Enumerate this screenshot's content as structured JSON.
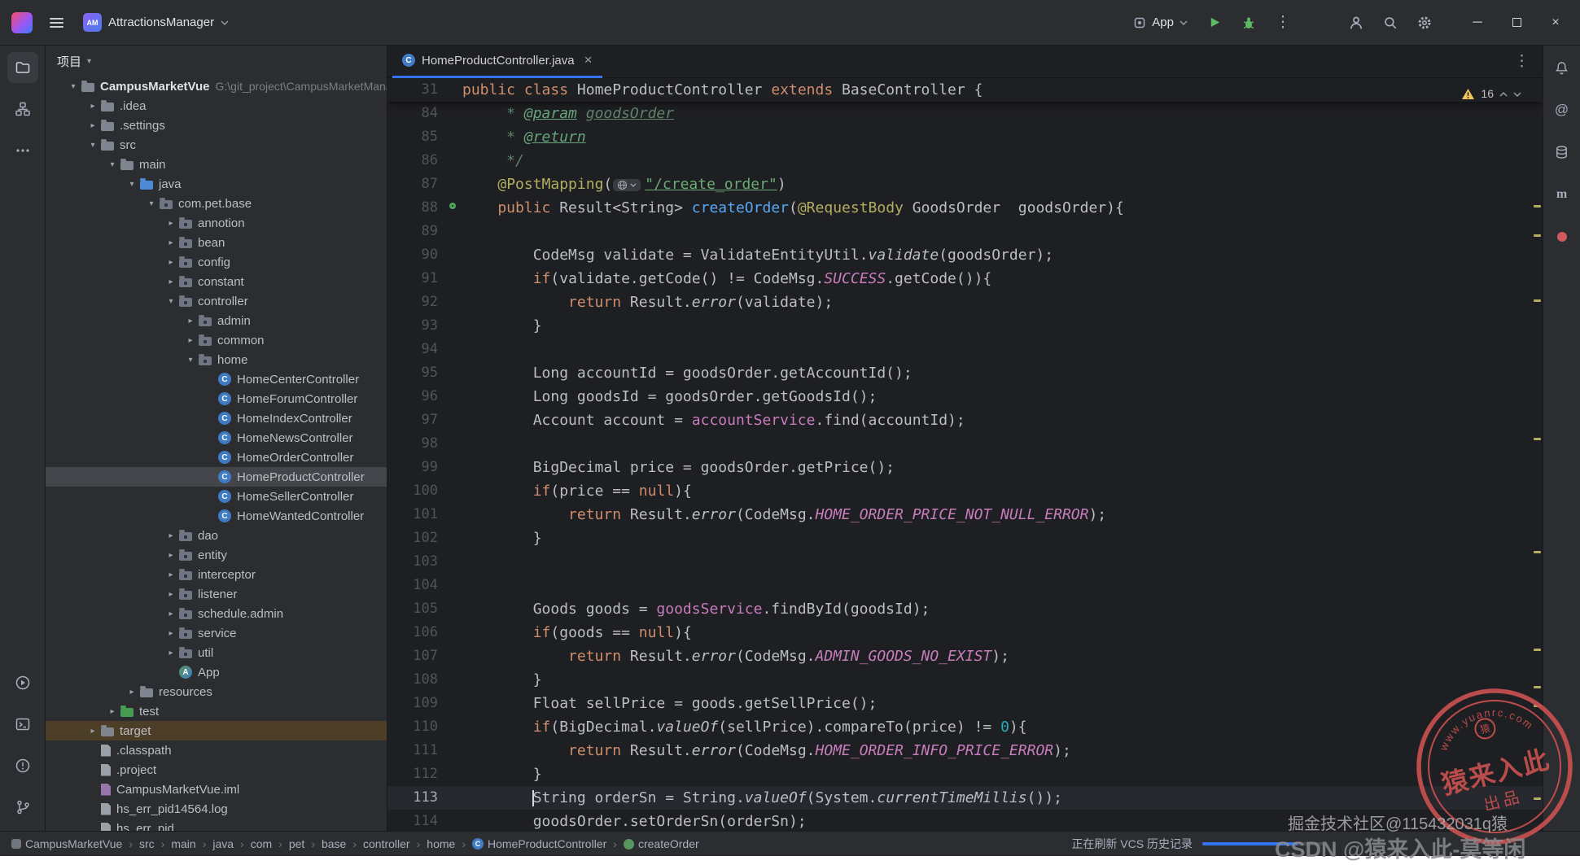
{
  "titlebar": {
    "project": "AttractionsManager",
    "project_badge": "AM",
    "run_config": "App"
  },
  "panel": {
    "header": "项目"
  },
  "tree": [
    {
      "l": 0,
      "c": "d",
      "i": "root",
      "t": "CampusMarketVue",
      "hint": "G:\\git_project\\CampusMarketManager\\Ca",
      "bold": true
    },
    {
      "l": 1,
      "c": "r",
      "i": "folder",
      "t": ".idea"
    },
    {
      "l": 1,
      "c": "r",
      "i": "folder",
      "t": ".settings"
    },
    {
      "l": 1,
      "c": "d",
      "i": "folder",
      "t": "src"
    },
    {
      "l": 2,
      "c": "d",
      "i": "folder",
      "t": "main"
    },
    {
      "l": 3,
      "c": "d",
      "i": "java",
      "t": "java"
    },
    {
      "l": 4,
      "c": "d",
      "i": "pkg",
      "t": "com.pet.base"
    },
    {
      "l": 5,
      "c": "r",
      "i": "pkg",
      "t": "annotion"
    },
    {
      "l": 5,
      "c": "r",
      "i": "pkg",
      "t": "bean"
    },
    {
      "l": 5,
      "c": "r",
      "i": "pkg",
      "t": "config"
    },
    {
      "l": 5,
      "c": "r",
      "i": "pkg",
      "t": "constant"
    },
    {
      "l": 5,
      "c": "d",
      "i": "pkg",
      "t": "controller"
    },
    {
      "l": 6,
      "c": "r",
      "i": "pkg",
      "t": "admin"
    },
    {
      "l": 6,
      "c": "r",
      "i": "pkg",
      "t": "common"
    },
    {
      "l": 6,
      "c": "d",
      "i": "pkg",
      "t": "home"
    },
    {
      "l": 7,
      "c": "",
      "i": "class",
      "t": "HomeCenterController"
    },
    {
      "l": 7,
      "c": "",
      "i": "class",
      "t": "HomeForumController"
    },
    {
      "l": 7,
      "c": "",
      "i": "class",
      "t": "HomeIndexController"
    },
    {
      "l": 7,
      "c": "",
      "i": "class",
      "t": "HomeNewsController"
    },
    {
      "l": 7,
      "c": "",
      "i": "class",
      "t": "HomeOrderController"
    },
    {
      "l": 7,
      "c": "",
      "i": "class",
      "t": "HomeProductController",
      "sel": true
    },
    {
      "l": 7,
      "c": "",
      "i": "class",
      "t": "HomeSellerController"
    },
    {
      "l": 7,
      "c": "",
      "i": "class",
      "t": "HomeWantedController"
    },
    {
      "l": 5,
      "c": "r",
      "i": "pkg",
      "t": "dao"
    },
    {
      "l": 5,
      "c": "r",
      "i": "pkg",
      "t": "entity"
    },
    {
      "l": 5,
      "c": "r",
      "i": "pkg",
      "t": "interceptor"
    },
    {
      "l": 5,
      "c": "r",
      "i": "pkg",
      "t": "listener"
    },
    {
      "l": 5,
      "c": "r",
      "i": "pkg",
      "t": "schedule.admin"
    },
    {
      "l": 5,
      "c": "r",
      "i": "pkg",
      "t": "service"
    },
    {
      "l": 5,
      "c": "r",
      "i": "pkg",
      "t": "util"
    },
    {
      "l": 5,
      "c": "",
      "i": "app",
      "t": "App"
    },
    {
      "l": 3,
      "c": "r",
      "i": "folder",
      "t": "resources"
    },
    {
      "l": 2,
      "c": "r",
      "i": "test",
      "t": "test"
    },
    {
      "l": 1,
      "c": "r",
      "i": "folder",
      "t": "target",
      "excl": true
    },
    {
      "l": 1,
      "c": "",
      "i": "file",
      "t": ".classpath"
    },
    {
      "l": 1,
      "c": "",
      "i": "file",
      "t": ".project"
    },
    {
      "l": 1,
      "c": "",
      "i": "module-file",
      "t": "CampusMarketVue.iml"
    },
    {
      "l": 1,
      "c": "",
      "i": "log",
      "t": "hs_err_pid14564.log"
    },
    {
      "l": 1,
      "c": "",
      "i": "log",
      "t": "hs_err_pid…"
    }
  ],
  "editor": {
    "tab": "HomeProductController.java",
    "warnings": "16",
    "sticky": {
      "n": "31",
      "tk": [
        [
          "k",
          "public class "
        ],
        [
          "p",
          "HomeProductController "
        ],
        [
          "k",
          "extends"
        ],
        [
          "p",
          " BaseController {"
        ]
      ]
    },
    "lines": [
      {
        "n": "84",
        "tk": [
          [
            "d",
            "     * "
          ],
          [
            "t",
            "@param"
          ],
          [
            "d",
            " "
          ],
          [
            "r",
            "goodsOrder"
          ]
        ]
      },
      {
        "n": "85",
        "tk": [
          [
            "d",
            "     * "
          ],
          [
            "t",
            "@return"
          ]
        ]
      },
      {
        "n": "86",
        "tk": [
          [
            "d",
            "     */"
          ]
        ]
      },
      {
        "n": "87",
        "tk": [
          [
            "p",
            "    "
          ],
          [
            "a",
            "@PostMapping"
          ],
          [
            "p",
            "("
          ],
          [
            "g",
            ""
          ],
          [
            "s",
            "\"/create_order\""
          ],
          [
            "p",
            ")"
          ]
        ]
      },
      {
        "n": "88",
        "g": "endpoint",
        "tk": [
          [
            "k",
            "    public "
          ],
          [
            "p",
            "Result<String> "
          ],
          [
            "m",
            "createOrder"
          ],
          [
            "p",
            "("
          ],
          [
            "a",
            "@RequestBody"
          ],
          [
            "p",
            " GoodsOrder  goodsOrder){"
          ]
        ]
      },
      {
        "n": "89",
        "tk": []
      },
      {
        "n": "90",
        "tk": [
          [
            "p",
            "        CodeMsg validate = ValidateEntityUtil."
          ],
          [
            "i",
            "validate"
          ],
          [
            "p",
            "(goodsOrder);"
          ]
        ]
      },
      {
        "n": "91",
        "tk": [
          [
            "p",
            "        "
          ],
          [
            "k",
            "if"
          ],
          [
            "p",
            "(validate.getCode() != CodeMsg."
          ],
          [
            "c",
            "SUCCESS"
          ],
          [
            "p",
            ".getCode()){"
          ]
        ]
      },
      {
        "n": "92",
        "tk": [
          [
            "p",
            "            "
          ],
          [
            "k",
            "return"
          ],
          [
            "p",
            " Result."
          ],
          [
            "i",
            "error"
          ],
          [
            "p",
            "(validate);"
          ]
        ]
      },
      {
        "n": "93",
        "tk": [
          [
            "p",
            "        }"
          ]
        ]
      },
      {
        "n": "94",
        "tk": []
      },
      {
        "n": "95",
        "tk": [
          [
            "p",
            "        Long accountId = goodsOrder.getAccountId();"
          ]
        ]
      },
      {
        "n": "96",
        "tk": [
          [
            "p",
            "        Long goodsId = goodsOrder.getGoodsId();"
          ]
        ]
      },
      {
        "n": "97",
        "tk": [
          [
            "p",
            "        Account account = "
          ],
          [
            "f",
            "accountService"
          ],
          [
            "p",
            ".find(accountId);"
          ]
        ]
      },
      {
        "n": "98",
        "tk": []
      },
      {
        "n": "99",
        "tk": [
          [
            "p",
            "        BigDecimal price = goodsOrder.getPrice();"
          ]
        ]
      },
      {
        "n": "100",
        "tk": [
          [
            "p",
            "        "
          ],
          [
            "k",
            "if"
          ],
          [
            "p",
            "(price == "
          ],
          [
            "k",
            "null"
          ],
          [
            "p",
            "){"
          ]
        ]
      },
      {
        "n": "101",
        "tk": [
          [
            "p",
            "            "
          ],
          [
            "k",
            "return"
          ],
          [
            "p",
            " Result."
          ],
          [
            "i",
            "error"
          ],
          [
            "p",
            "(CodeMsg."
          ],
          [
            "c",
            "HOME_ORDER_PRICE_NOT_NULL_ERROR"
          ],
          [
            "p",
            ");"
          ]
        ]
      },
      {
        "n": "102",
        "tk": [
          [
            "p",
            "        }"
          ]
        ]
      },
      {
        "n": "103",
        "tk": []
      },
      {
        "n": "104",
        "tk": []
      },
      {
        "n": "105",
        "tk": [
          [
            "p",
            "        Goods goods = "
          ],
          [
            "f",
            "goodsService"
          ],
          [
            "p",
            ".findById(goodsId);"
          ]
        ]
      },
      {
        "n": "106",
        "tk": [
          [
            "p",
            "        "
          ],
          [
            "k",
            "if"
          ],
          [
            "p",
            "(goods == "
          ],
          [
            "k",
            "null"
          ],
          [
            "p",
            "){"
          ]
        ]
      },
      {
        "n": "107",
        "tk": [
          [
            "p",
            "            "
          ],
          [
            "k",
            "return"
          ],
          [
            "p",
            " Result."
          ],
          [
            "i",
            "error"
          ],
          [
            "p",
            "(CodeMsg."
          ],
          [
            "c",
            "ADMIN_GOODS_NO_EXIST"
          ],
          [
            "p",
            ");"
          ]
        ]
      },
      {
        "n": "108",
        "tk": [
          [
            "p",
            "        }"
          ]
        ]
      },
      {
        "n": "109",
        "tk": [
          [
            "p",
            "        Float sellPrice = goods.getSellPrice();"
          ]
        ]
      },
      {
        "n": "110",
        "tk": [
          [
            "p",
            "        "
          ],
          [
            "k",
            "if"
          ],
          [
            "p",
            "(BigDecimal."
          ],
          [
            "i",
            "valueOf"
          ],
          [
            "p",
            "(sellPrice).compareTo(price) != "
          ],
          [
            "n2",
            "0"
          ],
          [
            "p",
            "){"
          ]
        ]
      },
      {
        "n": "111",
        "tk": [
          [
            "p",
            "            "
          ],
          [
            "k",
            "return"
          ],
          [
            "p",
            " Result."
          ],
          [
            "i",
            "error"
          ],
          [
            "p",
            "(CodeMsg."
          ],
          [
            "c",
            "HOME_ORDER_INFO_PRICE_ERROR"
          ],
          [
            "p",
            ");"
          ]
        ]
      },
      {
        "n": "112",
        "tk": [
          [
            "p",
            "        }"
          ]
        ]
      },
      {
        "n": "113",
        "cur": true,
        "tk": [
          [
            "p",
            "        "
          ],
          [
            "y",
            ""
          ],
          [
            "p",
            "String orderSn = String."
          ],
          [
            "i",
            "valueOf"
          ],
          [
            "p",
            "(System."
          ],
          [
            "i",
            "currentTimeMillis"
          ],
          [
            "p",
            "());"
          ]
        ]
      },
      {
        "n": "114",
        "tk": [
          [
            "p",
            "        goodsOrder.setOrderSn(orderSn);"
          ]
        ]
      }
    ],
    "stripe_marks": [
      156,
      192,
      272,
      442,
      581,
      701,
      747,
      770,
      884
    ]
  },
  "statusbar": {
    "breadcrumbs": [
      {
        "t": "CampusMarketVue",
        "i": "module"
      },
      {
        "t": "src"
      },
      {
        "t": "main"
      },
      {
        "t": "java"
      },
      {
        "t": "com"
      },
      {
        "t": "pet"
      },
      {
        "t": "base"
      },
      {
        "t": "controller"
      },
      {
        "t": "home"
      },
      {
        "t": "HomeProductController",
        "i": "class"
      },
      {
        "t": "createOrder",
        "i": "method"
      }
    ],
    "vcs": "正在刷新 VCS 历史记录"
  },
  "watermarks": {
    "juejin": "掘金技术社区@115432031q猿",
    "csdn": "CSDN @猿来入此-莫等闲",
    "stamp_site": "www.yuanrc.com",
    "stamp_logo": "猿",
    "stamp_main": "猿来入此",
    "stamp_sub": "出品"
  },
  "icons": {
    "chevron_down": "▾",
    "chevron_right": "▸",
    "kebab": "⋮",
    "close": "×",
    "minimize": "─",
    "maven": "m",
    "ai": "@",
    "class_letter": "C",
    "app_letter": "A",
    "tab_close": "×"
  }
}
